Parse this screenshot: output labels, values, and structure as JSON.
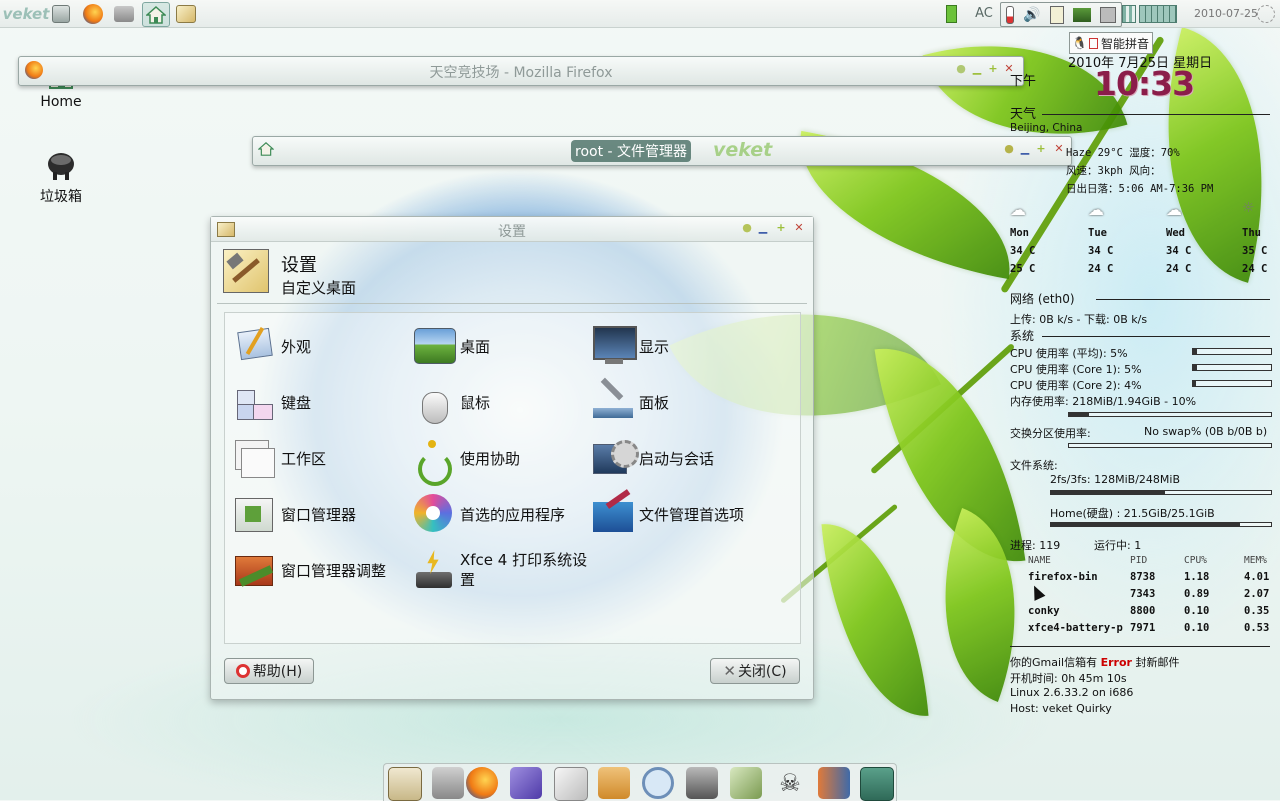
{
  "top_panel": {
    "logo": "veket",
    "status_ac": "AC",
    "date": "2010-07-25",
    "launchers": [
      "file-icon",
      "firefox-icon",
      "drive-icon",
      "home-icon",
      "image-icon"
    ]
  },
  "desktop": {
    "icons": [
      {
        "label": "Home",
        "icon": "home-icon"
      },
      {
        "label": "垃圾箱",
        "icon": "trash-icon"
      }
    ]
  },
  "windows": {
    "firefox": {
      "title": "天空竞技场 - Mozilla Firefox"
    },
    "file_manager": {
      "title": "root - 文件管理器",
      "watermark": "veket"
    }
  },
  "settings": {
    "window_title": "设置",
    "header_title": "设置",
    "header_subtitle": "自定义桌面",
    "items": [
      {
        "label": "外观",
        "icon": "appearance-icon"
      },
      {
        "label": "桌面",
        "icon": "desktop-icon"
      },
      {
        "label": "显示",
        "icon": "display-icon"
      },
      {
        "label": "键盘",
        "icon": "keyboard-icon"
      },
      {
        "label": "鼠标",
        "icon": "mouse-icon"
      },
      {
        "label": "面板",
        "icon": "panel-icon"
      },
      {
        "label": "工作区",
        "icon": "workspace-icon"
      },
      {
        "label": "使用协助",
        "icon": "accessibility-icon"
      },
      {
        "label": "启动与会话",
        "icon": "session-icon"
      },
      {
        "label": "窗口管理器",
        "icon": "window-manager-icon"
      },
      {
        "label": "首选的应用程序",
        "icon": "preferred-apps-icon"
      },
      {
        "label": "文件管理首选项",
        "icon": "file-manager-prefs-icon"
      },
      {
        "label": "窗口管理器调整",
        "icon": "wm-tweaks-icon"
      },
      {
        "label": "Xfce 4 打印系统设置",
        "icon": "printer-icon"
      }
    ],
    "help_button": "帮助(H)",
    "close_button": "关闭(C)"
  },
  "ime": {
    "label": "智能拼音"
  },
  "conky": {
    "date_line": "2010年 7月25日  星期日",
    "ampm": "下午",
    "time": "10:33",
    "weather_title": "天气",
    "location": "Beijing, China",
    "weather_line1": "Haze  29°C 湿度：70%",
    "weather_line2": "风速：3kph 风向：",
    "weather_line3": "日出日落：5:06 AM-7:36 PM",
    "forecast": [
      {
        "day": "Mon",
        "high": "34 C",
        "low": "25 C",
        "icon": "cloudy-icon"
      },
      {
        "day": "Tue",
        "high": "34 C",
        "low": "24 C",
        "icon": "cloud-icon"
      },
      {
        "day": "Wed",
        "high": "34 C",
        "low": "24 C",
        "icon": "cloud-icon"
      },
      {
        "day": "Thu",
        "high": "35 C",
        "low": "24 C",
        "icon": "sun-icon"
      }
    ],
    "network_title": "网络 (eth0)",
    "network_line": "上传: 0B   k/s - 下载: 0B   k/s",
    "system_title": "系统",
    "cpu_avg": "CPU 使用率 (平均): 5%",
    "cpu_core1": "CPU 使用率 (Core 1): 5%",
    "cpu_core2": "CPU 使用率 (Core 2): 4%",
    "mem": "内存使用率: 218MiB/1.94GiB - 10%",
    "cpu_avg_pct": 5,
    "cpu_core1_pct": 5,
    "cpu_core2_pct": 4,
    "mem_pct": 10,
    "swap_label": "交换分区使用率:",
    "swap_value": "No swap% (0B  b/0B  b)",
    "fs_title": "文件系统:",
    "fs_aufs": "2fs/3fs: 128MiB/248MiB",
    "fs_home": "Home(硬盘) : 21.5GiB/25.1GiB",
    "fs_aufs_pct": 52,
    "fs_home_pct": 86,
    "proc_count": "进程: 119",
    "proc_running": "运行中: 1",
    "proc_headers": [
      "NAME",
      "PID",
      "CPU%",
      "MEM%"
    ],
    "processes": [
      [
        "firefox-bin",
        "8738",
        "1.18",
        "4.01"
      ],
      [
        "",
        "7343",
        "0.89",
        "2.07"
      ],
      [
        "conky",
        "8800",
        "0.10",
        "0.35"
      ],
      [
        "xfce4-battery-p",
        "7971",
        "0.10",
        "0.53"
      ]
    ],
    "gmail_prefix": "你的Gmail信箱有",
    "gmail_error": "Error",
    "gmail_suffix": "封新邮件",
    "uptime": "开机时间:   0h 45m 10s",
    "kernel": "Linux 2.6.33.2 on i686",
    "host": "Host:  veket Quirky"
  },
  "dock": [
    "settings-icon",
    "tools-icon",
    "firefox-icon",
    "preferences-icon",
    "edit-icon",
    "shell-icon",
    "search-icon",
    "drive-icon",
    "lock-icon",
    "skull-icon",
    "door-icon",
    "screenshot-icon"
  ]
}
